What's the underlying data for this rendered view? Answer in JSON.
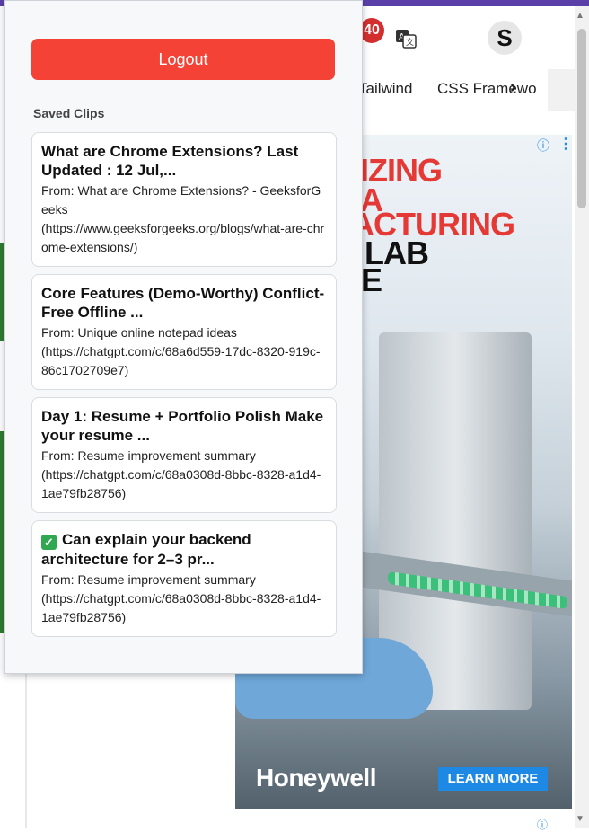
{
  "browser": {
    "notification_count": "40",
    "avatar_initial": "S",
    "nav_links": [
      "Tailwind",
      "CSS Framewo"
    ]
  },
  "ad": {
    "headline_lines": [
      "MIZING",
      "MA",
      "FACTURING",
      "LAB",
      "E"
    ],
    "brand": "Honeywell",
    "cta": "LEARN MORE",
    "info_icon": "ⓘ"
  },
  "popup": {
    "logout_label": "Logout",
    "saved_clips_heading": "Saved Clips",
    "clips": [
      {
        "title": "What are Chrome Extensions? Last Updated : 12 Jul,...",
        "from": "From: What are Chrome Extensions? - GeeksforGeeks",
        "url": "(https://www.geeksforgeeks.org/blogs/what-are-chrome-extensions/)"
      },
      {
        "title": "Core Features (Demo-Worthy) Conflict-Free Offline ...",
        "from": "From: Unique online notepad ideas",
        "url": "(https://chatgpt.com/c/68a6d559-17dc-8320-919c-86c1702709e7)"
      },
      {
        "title": "Day 1: Resume + Portfolio Polish Make your resume ...",
        "from": "From: Resume improvement summary",
        "url": "(https://chatgpt.com/c/68a0308d-8bbc-8328-a1d4-1ae79fb28756)"
      },
      {
        "title": "Can explain your backend architecture for 2–3 pr...",
        "title_icon": "check-mark-emoji-icon",
        "from": "From: Resume improvement summary",
        "url": "(https://chatgpt.com/c/68a0308d-8bbc-8328-a1d4-1ae79fb28756)"
      }
    ]
  },
  "colors": {
    "logout_button": "#f44336",
    "top_bar": "#5b3fa8",
    "ad_cta": "#1e88e5"
  }
}
